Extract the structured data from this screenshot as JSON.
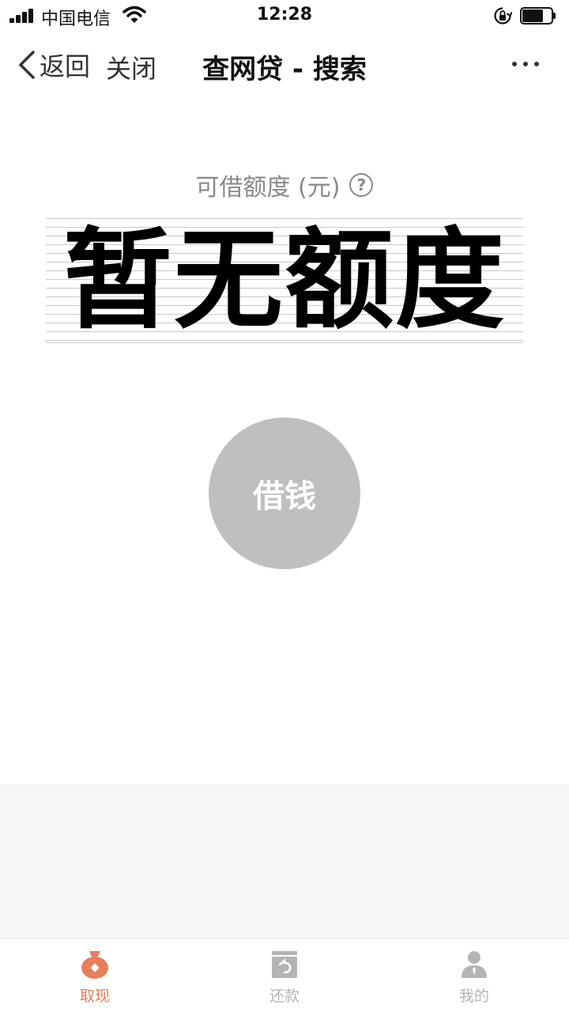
{
  "status_bar": {
    "carrier": "中国电信",
    "time": "12:28"
  },
  "nav": {
    "back_label": "返回",
    "close_label": "关闭",
    "title": "查网贷 - 搜索"
  },
  "quota": {
    "label": "可借额度 (元)",
    "help_icon": "?",
    "value": "暂无额度"
  },
  "borrow_button": {
    "label": "借钱"
  },
  "tabs": [
    {
      "label": "取现",
      "icon": "money-bag-icon",
      "active": true
    },
    {
      "label": "还款",
      "icon": "repay-icon",
      "active": false
    },
    {
      "label": "我的",
      "icon": "user-icon",
      "active": false
    }
  ],
  "colors": {
    "tab_active": "#e57f5c",
    "tab_inactive": "#b4b4b4",
    "borrow_button_bg": "#bfbfbf",
    "secondary_text": "#888888"
  }
}
